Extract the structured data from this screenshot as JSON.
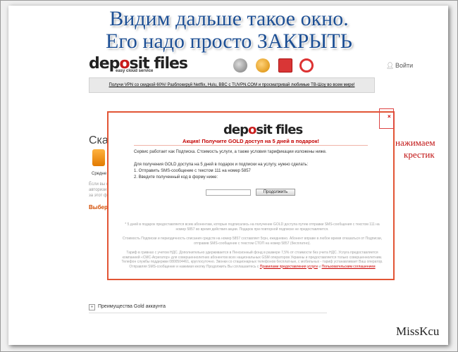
{
  "tutorial": {
    "heading_line1": "Видим дальше такое окно.",
    "heading_line2": "Его надо просто ЗАКРЫТЬ",
    "annotation_line1": "нажимаем",
    "annotation_line2": "крестик",
    "signature": "MissKcu"
  },
  "site": {
    "logo_part1": "dep",
    "logo_accent": "o",
    "logo_part2": "sit files",
    "tagline": "easy cloud service",
    "login_icon": "user-icon",
    "login_label": "Войти",
    "banner_text": "Получи VPN со скидкой 60%! Разблокируй Netflix, Hulu, BBC с TUVPN.COM и просматривай любимые ТВ-Шоу во всем мире!",
    "nav_icons": [
      "globe-icon",
      "gear-icon",
      "gift-icon",
      "lifebuoy-icon"
    ]
  },
  "background": {
    "title": "Скач",
    "medium_label": "Средне",
    "text_line1": "Ёсли вы с",
    "text_line2": "авторизи",
    "text_line3": "за этот ф",
    "choose_label": "Выбер",
    "gold_expander_icon": "+",
    "gold_label": "Преимущества Gold аккаунта"
  },
  "modal": {
    "logo_part1": "dep",
    "logo_accent": "o",
    "logo_part2": "sit files",
    "promo": "Акция! Получите GOLD доступ на 5 дней в подарок!",
    "close_label": "×",
    "intro": "Сервис работает как Подписка. Стоимость услуги, а также условия тарификации изложены ниже.",
    "instruction_title": "Для получения GOLD доступа на 5 дней в подарок и подписки на услугу, нужно сделать:",
    "step1": "1. Отправить SMS-сообщение с текстом 111 на номер 5857",
    "step2": "2. Введите полученный код в форму ниже:",
    "code_value": "",
    "submit_label": "Продолжить",
    "fine_print_1": "* 5 дней в подарок предоставляется всем абонентам, которые подписались на получение GOLD доступа путем отправки SMS-сообщения с текстом 111 на номер 5857 во время действия акции. Подарок при повторной подписке не предоставляется.",
    "fine_print_2": "Стоимость Подписки и периодичность списания средств на номер 5857 составляет 5грн, ежедневно. Абонент вправе в любое время отказаться от Подписки, отправив SMS-сообщение с текстом СТОП на номер 5857 (бесплатно).",
    "fine_print_3": "Тариф в гривнах с учетом НДС. Дополнительно удерживается в Пенсионный фонд в размере 7,5% от стоимости без учета НДС. Услуга предоставляется компанией «СМС-Агрегатор» для совершеннолетних абонентов всех национальных GSM операторов Украины и предоставляется только совершеннолетним. Телефон службы поддержки 0800504461, круглосуточно. Звонки со стационарных телефонов бесплатные, с мобильных - тариф устанавливает Ваш оператор. Отправляя SMS-сообщение и нажимая кнопку Продолжить Вы соглашаетесь с",
    "rules_link": "Правилами предоставления услуги",
    "and_word": "и",
    "agreement_link": "Пользовательским соглашением"
  }
}
